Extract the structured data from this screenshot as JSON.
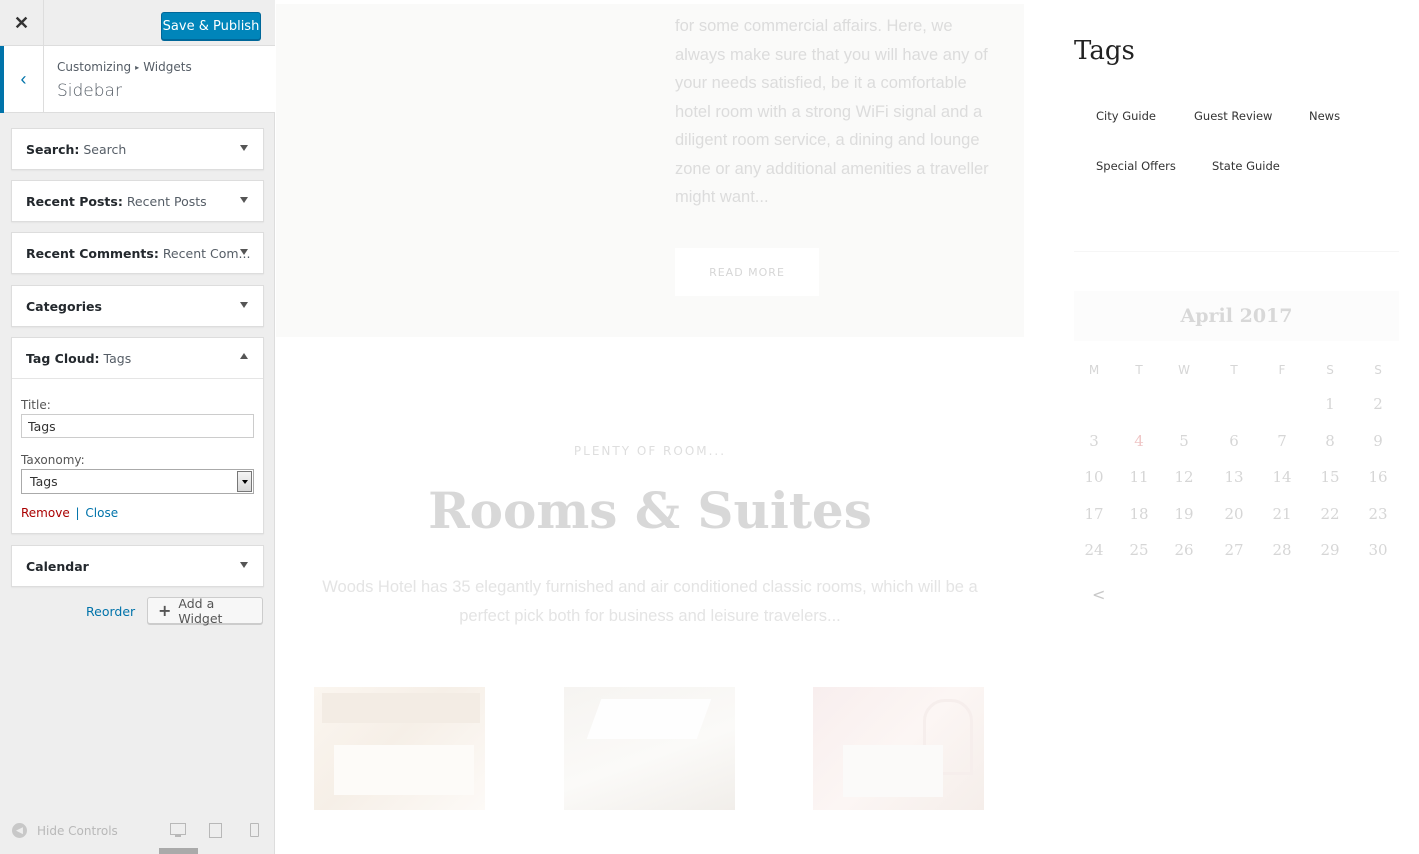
{
  "header": {
    "close_glyph": "✕",
    "save_label": "Save & Publish"
  },
  "section": {
    "back_glyph": "‹",
    "breadcrumb_root": "Customizing",
    "breadcrumb_sep": "▸",
    "breadcrumb_leaf": "Widgets",
    "title": "Sidebar"
  },
  "widgets": [
    {
      "type": "Search:",
      "title": "Search",
      "expanded": false
    },
    {
      "type": "Recent Posts:",
      "title": "Recent Posts",
      "expanded": false
    },
    {
      "type": "Recent Comments:",
      "title": "Recent Com...",
      "expanded": false
    },
    {
      "type": "Categories",
      "title": "",
      "expanded": false
    },
    {
      "type": "Tag Cloud:",
      "title": "Tags",
      "expanded": true
    },
    {
      "type": "Calendar",
      "title": "",
      "expanded": false
    }
  ],
  "tag_cloud_form": {
    "title_label": "Title:",
    "title_value": "Tags",
    "taxonomy_label": "Taxonomy:",
    "taxonomy_value": "Tags",
    "remove_label": "Remove",
    "separator": "|",
    "close_label": "Close"
  },
  "actions": {
    "reorder_label": "Reorder",
    "add_widget_plus": "+",
    "add_widget_label": "Add a Widget"
  },
  "footer": {
    "hide_controls_label": "Hide Controls"
  },
  "preview": {
    "excerpt": "for some commercial affairs. Here, we always make sure that you will have any of your needs satisfied, be it a comfortable hotel room with a strong WiFi signal and a diligent room service, a dining and lounge zone or any additional amenities a traveller might want...",
    "read_more": "READ MORE",
    "rooms_kicker": "PLENTY OF ROOM...",
    "rooms_title": "Rooms & Suites",
    "rooms_desc": "Woods Hotel has 35 elegantly furnished and air conditioned classic rooms, which will be a perfect pick both for business and leisure travelers...",
    "tags_title": "Tags",
    "tags": [
      "City Guide",
      "Guest Review",
      "News",
      "Special Offers",
      "State Guide"
    ],
    "calendar": {
      "month": "April 2017",
      "weekdays": [
        "M",
        "T",
        "W",
        "T",
        "F",
        "S",
        "S"
      ],
      "first_weekday_index": 5,
      "days_in_month": 30,
      "today": 4,
      "prev_glyph": "<"
    }
  }
}
